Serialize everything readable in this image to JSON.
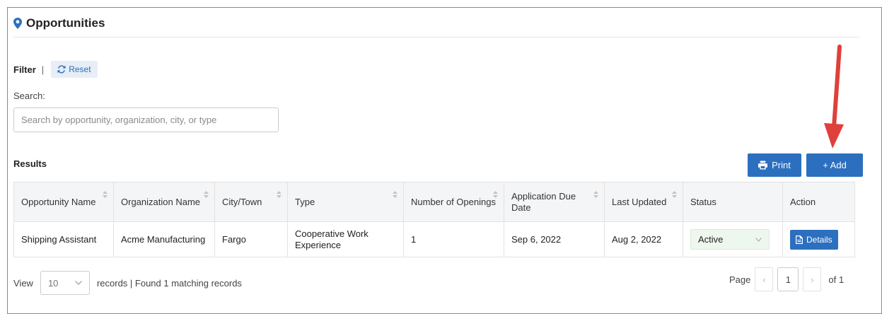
{
  "header": {
    "title": "Opportunities",
    "icon": "map-marker-icon"
  },
  "filter": {
    "label": "Filter",
    "separator": "|",
    "reset_label": "Reset"
  },
  "search": {
    "label": "Search:",
    "placeholder": "Search by opportunity, organization, city, or type",
    "value": ""
  },
  "results": {
    "label": "Results",
    "print_label": "Print",
    "add_label": "+ Add",
    "columns": [
      "Opportunity Name",
      "Organization Name",
      "City/Town",
      "Type",
      "Number of Openings",
      "Application Due Date",
      "Last Updated",
      "Status",
      "Action"
    ],
    "rows": [
      {
        "opportunity": "Shipping Assistant",
        "organization": "Acme Manufacturing",
        "city": "Fargo",
        "type": "Cooperative Work Experience",
        "openings": "1",
        "due_date": "Sep 6, 2022",
        "last_updated": "Aug 2, 2022",
        "status": "Active",
        "action": "Details"
      }
    ]
  },
  "footer": {
    "view_label": "View",
    "page_size": "10",
    "records_text": "records | Found 1 matching records",
    "page_label": "Page",
    "prev": "‹",
    "current_page": "1",
    "next": "›",
    "of_text": "of 1"
  },
  "colors": {
    "primary": "#2c6fbf",
    "annotation_arrow": "#e0403a",
    "status_bg": "#eef7ee"
  }
}
